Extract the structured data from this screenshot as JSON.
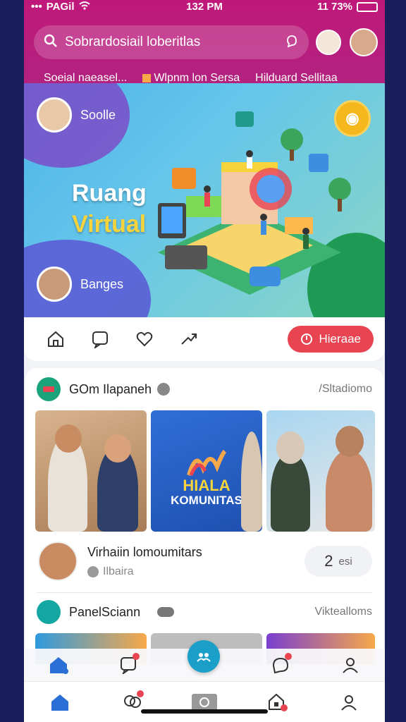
{
  "status_bar": {
    "carrier": "PAGil",
    "time": "132 PM",
    "battery": "11 73%"
  },
  "search": {
    "placeholder": "Sobrardosiail loberitlas"
  },
  "chips": [
    "Soeial naeasel...",
    "Wlpnm lon Sersa",
    "Hilduard Sellitaa"
  ],
  "banner": {
    "title_line1": "Ruang",
    "title_line2": "Virtual",
    "user_top": "Soolle",
    "user_bottom": "Banges"
  },
  "actions": {
    "join_label": "Hieraae"
  },
  "feed": {
    "group1_name": "GOm Ilapaneh",
    "group1_meta": "/Sltadiomo",
    "photo2_text1": "HIALA",
    "photo2_text2": "KOMUNITAS",
    "post_title": "Virhaiin lomoumitars",
    "post_sub": "Ilbaira",
    "count_num": "2",
    "count_unit": "esi",
    "group2_name": "PanelSciann",
    "group2_meta": "Viktealloms"
  },
  "colors": {
    "header": "#c0187a",
    "accent": "#e84452",
    "fab": "#1aa0c8"
  }
}
